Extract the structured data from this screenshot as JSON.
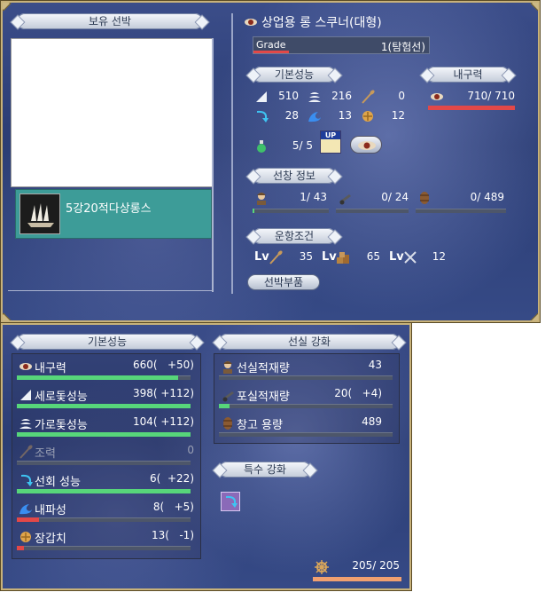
{
  "top": {
    "owned_header": "보유 선박",
    "ship_list": [
      {
        "name": "5강20적다상롱스"
      }
    ],
    "ship_title": "상업용 롱 스쿠너(대형)",
    "grade": {
      "label": "Grade",
      "value": "1(탐험선)",
      "level": 0.2
    },
    "basic_header": "기본성능",
    "durability_header": "내구력",
    "durability": {
      "value": "710/ 710",
      "level": 1.0
    },
    "stats": [
      {
        "icon": "vertical-sail-icon",
        "value": "510"
      },
      {
        "icon": "horizontal-sail-icon",
        "value": "216"
      },
      {
        "icon": "oar-icon",
        "value": "0"
      },
      {
        "icon": "turn-arrow-icon",
        "value": "28"
      },
      {
        "icon": "wave-icon",
        "value": "13"
      },
      {
        "icon": "armor-icon",
        "value": "12"
      }
    ],
    "upgrade": {
      "icon": "potion-icon",
      "value": "5/ 5",
      "up_label": "UP"
    },
    "cabin_header": "선창 정보",
    "cabin": [
      {
        "icon": "sailor-icon",
        "value": "1/ 43",
        "level": 0.02
      },
      {
        "icon": "cannon-icon",
        "value": "0/ 24",
        "level": 0.0
      },
      {
        "icon": "barrel-icon",
        "value": "0/ 489",
        "level": 0.0
      }
    ],
    "sailing_header": "운항조건",
    "sailing": [
      {
        "prefix": "Lv",
        "icon": "oar-icon",
        "value": "35"
      },
      {
        "prefix": "Lv",
        "icon": "cargo-icon",
        "value": "65"
      },
      {
        "prefix": "Lv",
        "icon": "crossed-swords-icon",
        "value": "12"
      }
    ],
    "parts_button": "선박부품"
  },
  "bottom": {
    "basic_header": "기본성능",
    "stats": [
      {
        "icon": "eye-icon",
        "label": "내구력",
        "value": "660(   +50)",
        "level": 0.93,
        "dim": false
      },
      {
        "icon": "vertical-sail-icon",
        "label": "세로돛성능",
        "value": "398( +112)",
        "level": 1.0,
        "dim": false
      },
      {
        "icon": "horizontal-sail-icon",
        "label": "가로돛성능",
        "value": "104( +112)",
        "level": 1.0,
        "dim": false
      },
      {
        "icon": "oar-icon",
        "label": "조력",
        "value": "0",
        "level": 0.0,
        "dim": true
      },
      {
        "icon": "turn-arrow-icon",
        "label": "선회 성능",
        "value": "6(  +22)",
        "level": 1.0,
        "dim": false
      },
      {
        "icon": "wave-icon",
        "label": "내파성",
        "value": "8(   +5)",
        "level": 0.13,
        "dim": false
      },
      {
        "icon": "armor-icon",
        "label": "장갑치",
        "value": "13(   -1)",
        "level": 0.04,
        "dim": false
      }
    ],
    "cabin_header": "선실 강화",
    "cabin": [
      {
        "icon": "sailor-icon",
        "label": "선실적재량",
        "value": "43",
        "level": 0.0
      },
      {
        "icon": "cannon-icon",
        "label": "포실적재량",
        "value": "20(   +4)",
        "level": 0.06
      },
      {
        "icon": "barrel-icon",
        "label": "창고 용량",
        "value": "489",
        "level": 0.0
      }
    ],
    "special_header": "특수 강화",
    "special_icon": "turn-arrow-icon",
    "sailors": {
      "icon": "wheel-icon",
      "value": "205/ 205",
      "level": 1.0
    }
  },
  "colors": {
    "green": "#57d67a",
    "red": "#e24848",
    "teal": "#3a9a96",
    "gold": "#c8b27a"
  }
}
